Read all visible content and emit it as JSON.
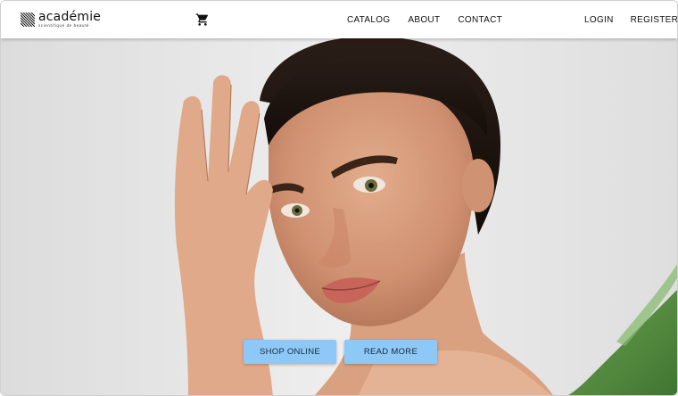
{
  "header": {
    "logo": {
      "word": "académie",
      "tagline": "scientifique de beauté"
    },
    "cart_icon": "shopping-cart-icon",
    "nav_center": [
      {
        "label": "CATALOG"
      },
      {
        "label": "ABOUT"
      },
      {
        "label": "CONTACT"
      }
    ],
    "nav_right": [
      {
        "label": "LOGIN"
      },
      {
        "label": "REGISTER"
      }
    ]
  },
  "hero": {
    "image": "woman-portrait-with-aloe-leaf",
    "buttons": {
      "shop_online": "SHOP ONLINE",
      "read_more": "READ MORE"
    }
  },
  "colors": {
    "button_bg": "#8ec8f6",
    "header_bg": "#ffffff",
    "hero_bg": "#e8e8e8",
    "aloe_green": "#4f8a3a"
  }
}
